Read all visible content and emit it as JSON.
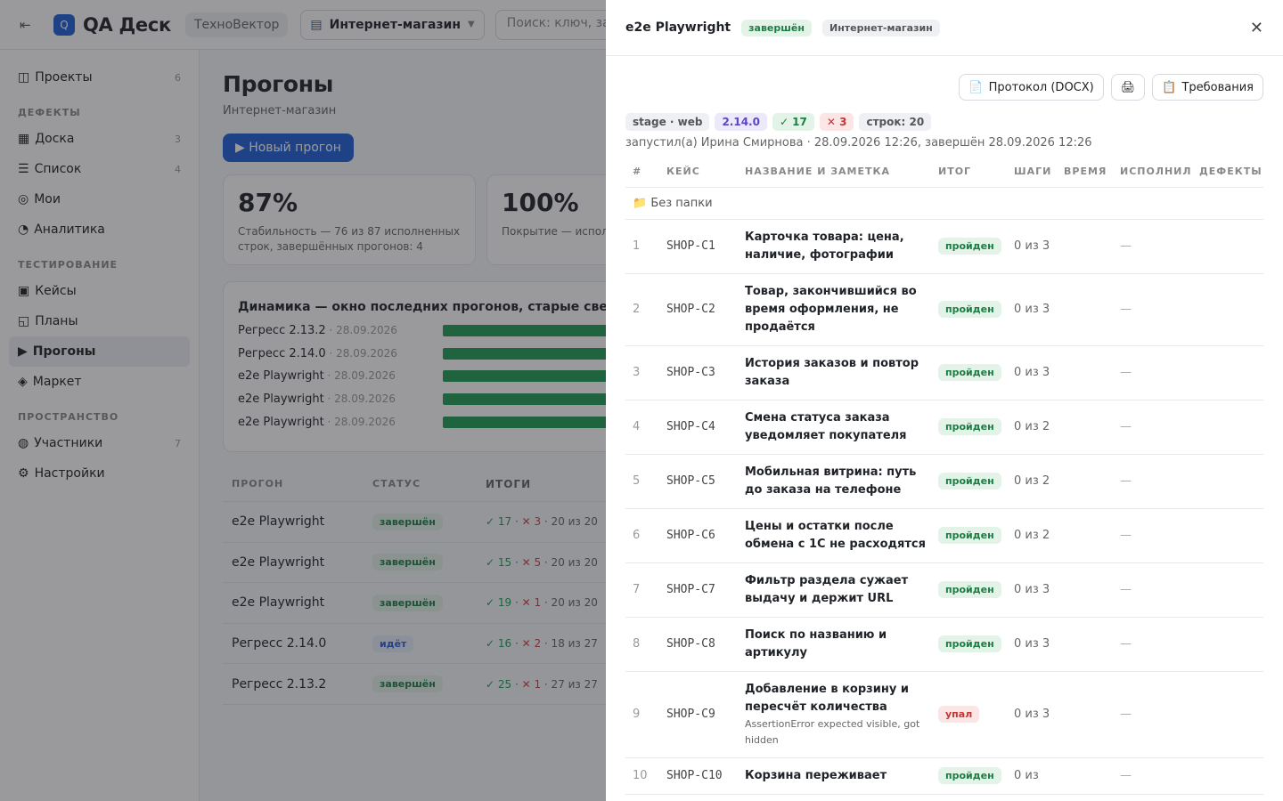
{
  "topbar": {
    "collapse_icon": "⇤",
    "logo_letter": "Q",
    "logo_text": "QA Деск",
    "workspace": "ТехноВектор",
    "project": "Интернет-магазин",
    "search_placeholder": "Поиск: ключ, загол"
  },
  "sidebar": {
    "items_top": [
      {
        "icon": "◫",
        "label": "Проекты",
        "count": "6"
      }
    ],
    "section_defects": "ДЕФЕКТЫ",
    "items_defects": [
      {
        "icon": "▦",
        "label": "Доска",
        "count": "3"
      },
      {
        "icon": "☰",
        "label": "Список",
        "count": "4"
      },
      {
        "icon": "◎",
        "label": "Мои",
        "count": ""
      },
      {
        "icon": "◔",
        "label": "Аналитика",
        "count": ""
      }
    ],
    "section_testing": "ТЕСТИРОВАНИЕ",
    "items_testing": [
      {
        "icon": "▣",
        "label": "Кейсы",
        "count": ""
      },
      {
        "icon": "◱",
        "label": "Планы",
        "count": ""
      },
      {
        "icon": "▶",
        "label": "Прогоны",
        "count": ""
      },
      {
        "icon": "◈",
        "label": "Маркет",
        "count": ""
      }
    ],
    "section_space": "ПРОСТРАНСТВО",
    "items_space": [
      {
        "icon": "◍",
        "label": "Участники",
        "count": "7"
      },
      {
        "icon": "⚙",
        "label": "Настройки",
        "count": ""
      }
    ]
  },
  "main": {
    "title": "Прогоны",
    "subtitle": "Интернет-магазин",
    "new_run": "▶ Новый прогон",
    "stats": [
      {
        "value": "87%",
        "desc": "Стабильность — 76 из 87 исполненных строк, завершённых прогонов: 4"
      },
      {
        "value": "100%",
        "desc": "Покрытие — исполнено кейсов"
      }
    ],
    "dynamics_title": "Динамика — окно последних прогонов, старые сверху",
    "dynamics": [
      {
        "name": "Регресс 2.13.2",
        "date": " · 28.09.2026"
      },
      {
        "name": "Регресс 2.14.0",
        "date": " · 28.09.2026"
      },
      {
        "name": "e2e Playwright",
        "date": " · 28.09.2026"
      },
      {
        "name": "e2e Playwright",
        "date": " · 28.09.2026"
      },
      {
        "name": "e2e Playwright",
        "date": " · 28.09.2026"
      }
    ],
    "runs_head": {
      "name": "ПРОГОН",
      "status": "СТАТУС",
      "results": "ИТОГИ"
    },
    "runs": [
      {
        "name": "e2e Playwright",
        "status": "завершён",
        "status_kind": "done",
        "ok": "✓ 17",
        "fail": "✕ 3",
        "total": " · 20 из 20"
      },
      {
        "name": "e2e Playwright",
        "status": "завершён",
        "status_kind": "done",
        "ok": "✓ 15",
        "fail": "✕ 5",
        "total": " · 20 из 20"
      },
      {
        "name": "e2e Playwright",
        "status": "завершён",
        "status_kind": "done",
        "ok": "✓ 19",
        "fail": "✕ 1",
        "total": " · 20 из 20"
      },
      {
        "name": "Регресс 2.14.0",
        "status": "идёт",
        "status_kind": "going",
        "ok": "✓ 16",
        "fail": "✕ 2",
        "total": " · 18 из 27"
      },
      {
        "name": "Регресс 2.13.2",
        "status": "завершён",
        "status_kind": "done",
        "ok": "✓ 25",
        "fail": "✕ 1",
        "total": " · 27 из 27"
      }
    ]
  },
  "drawer": {
    "title": "e2e Playwright",
    "status": "завершён",
    "project": "Интернет-магазин",
    "close_icon": "✕",
    "protocol_btn": "Протокол (DOCX)",
    "print_icon": "🖨",
    "requirements_btn": "Требования",
    "chips": {
      "env": "stage · web",
      "version": "2.14.0",
      "passed": "✓ 17",
      "failed": "✕ 3",
      "rows": "строк: 20"
    },
    "meta": "запустил(а) Ирина Смирнова · 28.09.2026 12:26, завершён 28.09.2026 12:26",
    "columns": [
      "#",
      "КЕЙС",
      "НАЗВАНИЕ И ЗАМЕТКА",
      "ИТОГ",
      "ШАГИ",
      "ВРЕМЯ",
      "ИСПОЛНИЛ",
      "ДЕФЕКТЫ"
    ],
    "folder": "📁 Без папки",
    "rows": [
      {
        "n": "1",
        "key": "SHOP-C1",
        "title": "Карточка товара: цена, наличие, фотографии",
        "note": "",
        "result": "пройден",
        "kind": "pass",
        "steps": "0 из 3",
        "time": "",
        "by": "—",
        "defects": ""
      },
      {
        "n": "2",
        "key": "SHOP-C2",
        "title": "Товар, закончившийся во время оформления, не продаётся",
        "note": "",
        "result": "пройден",
        "kind": "pass",
        "steps": "0 из 3",
        "time": "",
        "by": "—",
        "defects": ""
      },
      {
        "n": "3",
        "key": "SHOP-C3",
        "title": "История заказов и повтор заказа",
        "note": "",
        "result": "пройден",
        "kind": "pass",
        "steps": "0 из 3",
        "time": "",
        "by": "—",
        "defects": ""
      },
      {
        "n": "4",
        "key": "SHOP-C4",
        "title": "Смена статуса заказа уведомляет покупателя",
        "note": "",
        "result": "пройден",
        "kind": "pass",
        "steps": "0 из 2",
        "time": "",
        "by": "—",
        "defects": ""
      },
      {
        "n": "5",
        "key": "SHOP-C5",
        "title": "Мобильная витрина: путь до заказа на телефоне",
        "note": "",
        "result": "пройден",
        "kind": "pass",
        "steps": "0 из 2",
        "time": "",
        "by": "—",
        "defects": ""
      },
      {
        "n": "6",
        "key": "SHOP-C6",
        "title": "Цены и остатки после обмена с 1С не расходятся",
        "note": "",
        "result": "пройден",
        "kind": "pass",
        "steps": "0 из 2",
        "time": "",
        "by": "—",
        "defects": ""
      },
      {
        "n": "7",
        "key": "SHOP-C7",
        "title": "Фильтр раздела сужает выдачу и держит URL",
        "note": "",
        "result": "пройден",
        "kind": "pass",
        "steps": "0 из 3",
        "time": "",
        "by": "—",
        "defects": ""
      },
      {
        "n": "8",
        "key": "SHOP-C8",
        "title": "Поиск по названию и артикулу",
        "note": "",
        "result": "пройден",
        "kind": "pass",
        "steps": "0 из 3",
        "time": "",
        "by": "—",
        "defects": ""
      },
      {
        "n": "9",
        "key": "SHOP-C9",
        "title": "Добавление в корзину и пересчёт количества",
        "note": "AssertionError expected visible, got hidden",
        "result": "упал",
        "kind": "fail",
        "steps": "0 из 3",
        "time": "",
        "by": "—",
        "defects": ""
      },
      {
        "n": "10",
        "key": "SHOP-C10",
        "title": "Корзина переживает",
        "note": "",
        "result": "пройден",
        "kind": "pass",
        "steps": "0 из",
        "time": "",
        "by": "—",
        "defects": ""
      }
    ]
  }
}
